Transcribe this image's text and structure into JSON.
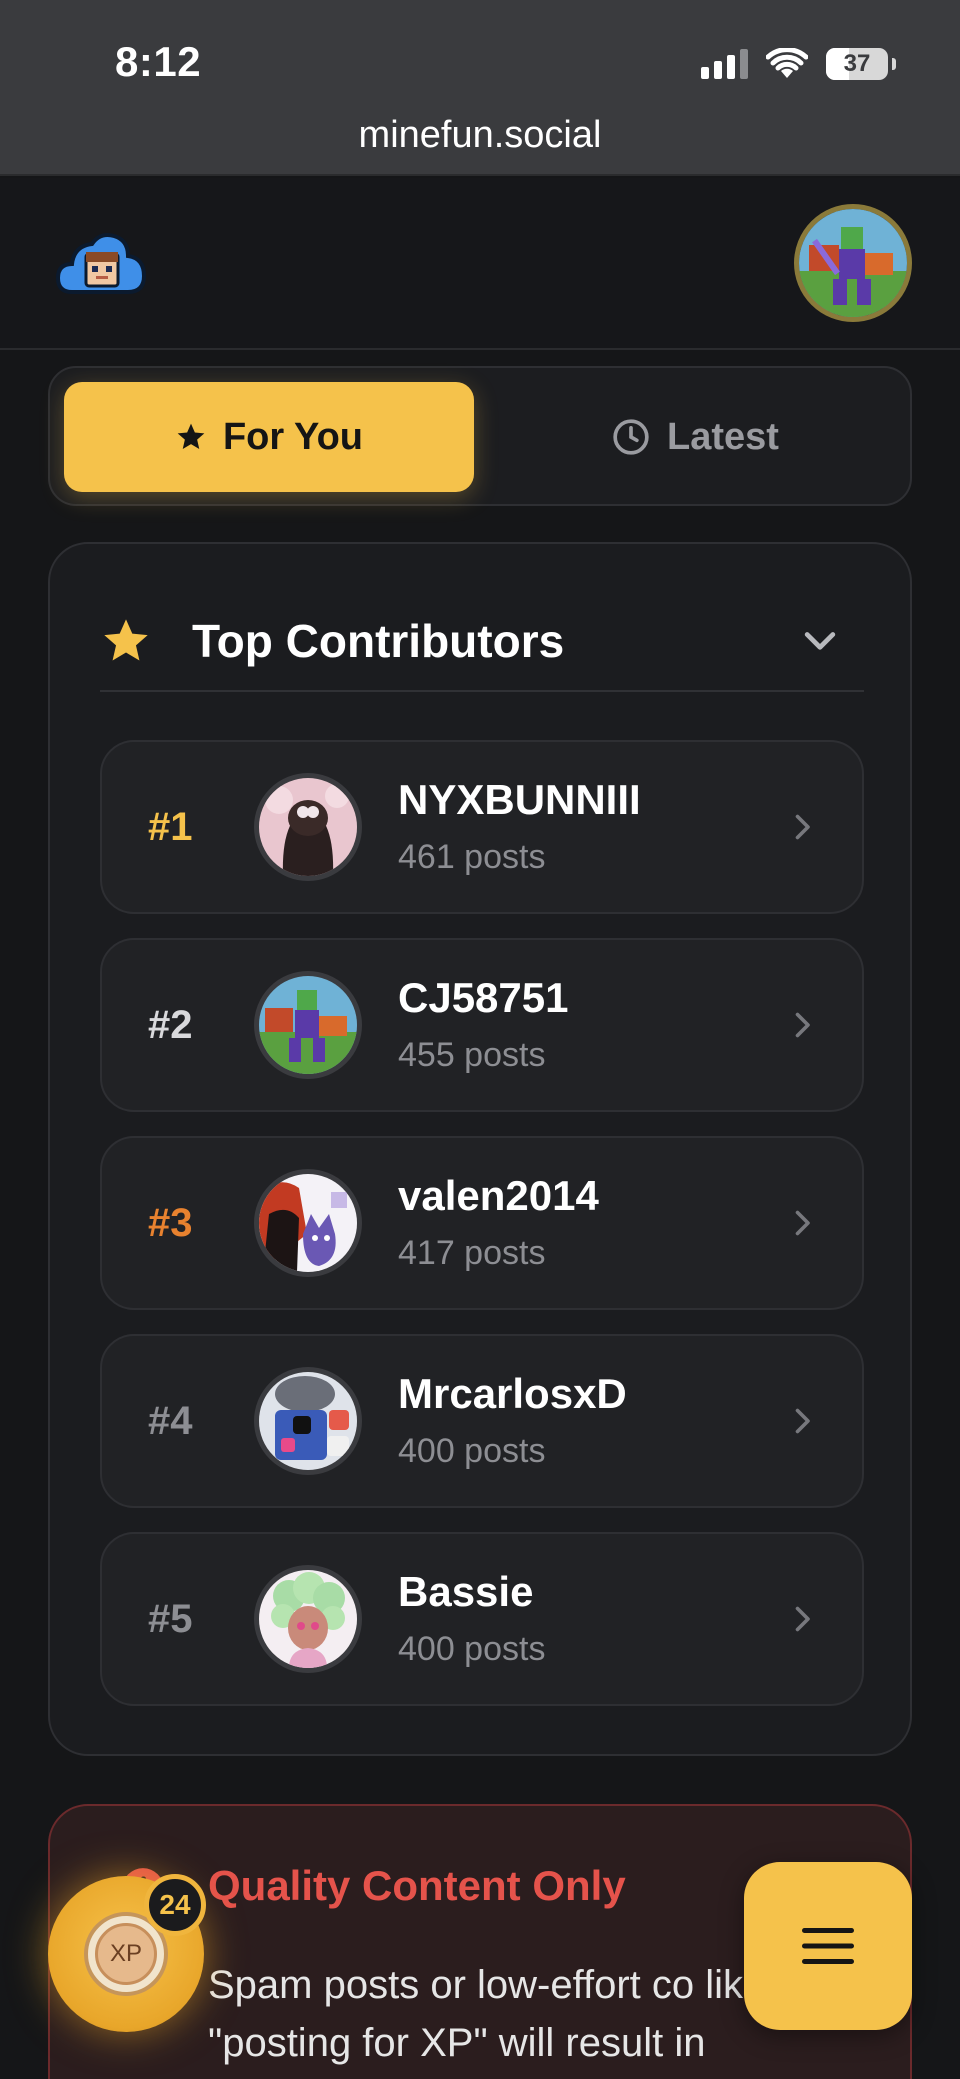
{
  "status_bar": {
    "time": "8:12",
    "battery": "37"
  },
  "browser": {
    "url": "minefun.social"
  },
  "tabs": [
    {
      "label": "For You",
      "icon": "star-icon",
      "active": true
    },
    {
      "label": "Latest",
      "icon": "clock-icon",
      "active": false
    }
  ],
  "contributors": {
    "title": "Top Contributors",
    "items": [
      {
        "rank": "#1",
        "name": "NYXBUNNIII",
        "posts": "461 posts",
        "rank_color": "#f5c24b"
      },
      {
        "rank": "#2",
        "name": "CJ58751",
        "posts": "455 posts",
        "rank_color": "#d9d9dc"
      },
      {
        "rank": "#3",
        "name": "valen2014",
        "posts": "417 posts",
        "rank_color": "#e8822f"
      },
      {
        "rank": "#4",
        "name": "MrcarlosxD",
        "posts": "400 posts",
        "rank_color": "#8d8e93"
      },
      {
        "rank": "#5",
        "name": "Bassie",
        "posts": "400 posts",
        "rank_color": "#8d8e93"
      }
    ]
  },
  "notice": {
    "title": "Quality Content Only",
    "text": "Spam posts or low-effort co like \"posting for XP\" will result in"
  },
  "xp": {
    "label": "XP",
    "level": "24"
  },
  "colors": {
    "accent": "#f5c24b",
    "background": "#151618",
    "danger": "#e5534b"
  }
}
